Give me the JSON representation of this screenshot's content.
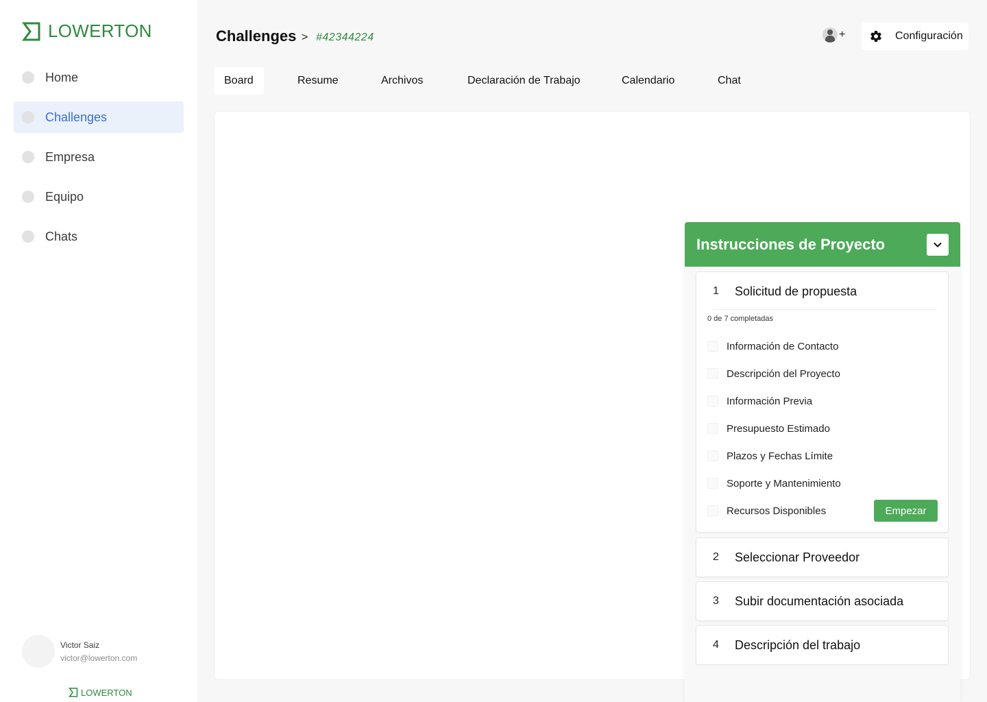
{
  "brand": {
    "name": "LOWERTON",
    "color": "#2e8a3e"
  },
  "sidebar": {
    "items": [
      {
        "label": "Home",
        "icon": "dot-icon",
        "active": false
      },
      {
        "label": "Challenges",
        "icon": "dot-icon",
        "active": true
      },
      {
        "label": "Empresa",
        "icon": "dot-icon",
        "active": false
      },
      {
        "label": "Equipo",
        "icon": "dot-icon",
        "active": false
      },
      {
        "label": "Chats",
        "icon": "dot-icon",
        "active": false
      }
    ],
    "user": {
      "name": "Victor Saiz",
      "email": "victor@lowerton.com"
    },
    "footer_brand": "LOWERTON"
  },
  "header": {
    "title": "Challenges",
    "separator": ">",
    "challenge_id": "#42344224",
    "add_member_icon": "add-user-icon",
    "add_member_plus": "+",
    "config_label": "Configuración",
    "config_icon": "gear-icon"
  },
  "tabs": [
    {
      "label": "Board",
      "active": true
    },
    {
      "label": "Resume",
      "active": false
    },
    {
      "label": "Archivos",
      "active": false
    },
    {
      "label": "Declaración de Trabajo",
      "active": false
    },
    {
      "label": "Calendario",
      "active": false
    },
    {
      "label": "Chat",
      "active": false
    }
  ],
  "instructions": {
    "title": "Instrucciones de Proyecto",
    "header_color": "#4caa58",
    "collapse_icon": "chevron-down-icon",
    "steps": [
      {
        "number": "1",
        "title": "Solicitud de propuesta",
        "progress": "0 de 7 completadas",
        "items": [
          "Información de Contacto",
          "Descripción del Proyecto",
          "Información Previa",
          "Presupuesto Estimado",
          "Plazos y Fechas Límite",
          "Soporte y Mantenimiento",
          "Recursos Disponibles"
        ],
        "action_label": "Empezar"
      },
      {
        "number": "2",
        "title": "Seleccionar Proveedor"
      },
      {
        "number": "3",
        "title": "Subir documentación asociada"
      },
      {
        "number": "4",
        "title": "Descripción del trabajo"
      }
    ]
  }
}
